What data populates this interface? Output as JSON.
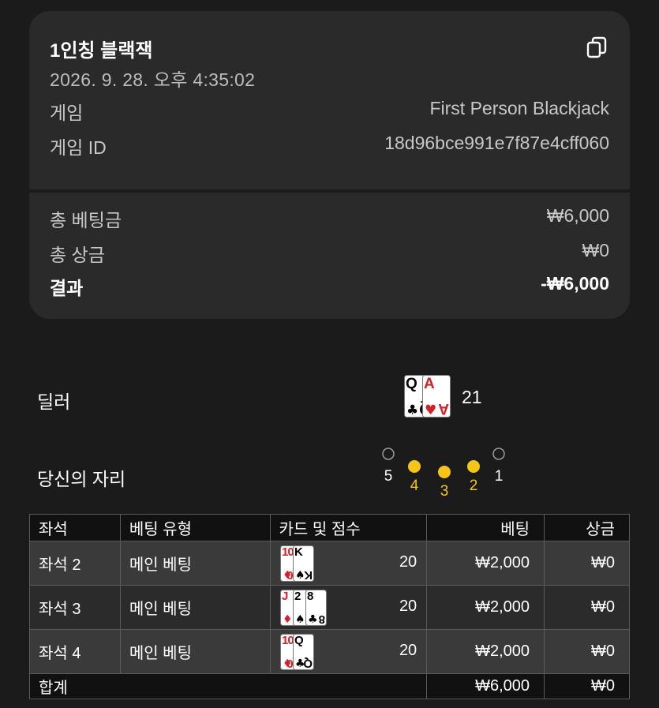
{
  "summary": {
    "title": "1인칭 블랙잭",
    "datetime": "2026. 9. 28. 오후 4:35:02",
    "game_label": "게임",
    "game_value": "First Person Blackjack",
    "game_id_label": "게임 ID",
    "game_id_value": "18d96bce991e7f87e4cff060",
    "total_bet_label": "총 베팅금",
    "total_bet_value": "₩6,000",
    "total_win_label": "총 상금",
    "total_win_value": "₩0",
    "result_label": "결과",
    "result_value": "-₩6,000"
  },
  "dealer": {
    "label": "딜러",
    "score": "21",
    "cards": [
      {
        "rank": "Q",
        "suit": "♣",
        "color": "#000000"
      },
      {
        "rank": "A",
        "suit": "♥",
        "color": "#d61f26"
      }
    ]
  },
  "seats": {
    "label": "당신의 자리",
    "positions": [
      {
        "number": "5",
        "active": false
      },
      {
        "number": "4",
        "active": true
      },
      {
        "number": "3",
        "active": true
      },
      {
        "number": "2",
        "active": true
      },
      {
        "number": "1",
        "active": false
      }
    ],
    "active_color": "#f5c518",
    "inactive_color": "#9a9a9a"
  },
  "table": {
    "headers": {
      "seat": "좌석",
      "bet_type": "베팅 유형",
      "cards": "카드 및 점수",
      "bet": "베팅",
      "win": "상금"
    },
    "rows": [
      {
        "seat": "좌석 2",
        "bet_type": "메인 베팅",
        "score": "20",
        "bet": "₩2,000",
        "win": "₩0",
        "cards": [
          {
            "rank": "10",
            "suit": "♦",
            "color": "#d61f26"
          },
          {
            "rank": "K",
            "suit": "♠",
            "color": "#000000"
          }
        ]
      },
      {
        "seat": "좌석 3",
        "bet_type": "메인 베팅",
        "score": "20",
        "bet": "₩2,000",
        "win": "₩0",
        "cards": [
          {
            "rank": "J",
            "suit": "♦",
            "color": "#d61f26"
          },
          {
            "rank": "2",
            "suit": "♠",
            "color": "#000000"
          },
          {
            "rank": "8",
            "suit": "♣",
            "color": "#000000"
          }
        ]
      },
      {
        "seat": "좌석 4",
        "bet_type": "메인 베팅",
        "score": "20",
        "bet": "₩2,000",
        "win": "₩0",
        "cards": [
          {
            "rank": "10",
            "suit": "♦",
            "color": "#d61f26"
          },
          {
            "rank": "Q",
            "suit": "♣",
            "color": "#000000"
          }
        ]
      }
    ],
    "total": {
      "label": "합계",
      "bet": "₩6,000",
      "win": "₩0"
    }
  }
}
